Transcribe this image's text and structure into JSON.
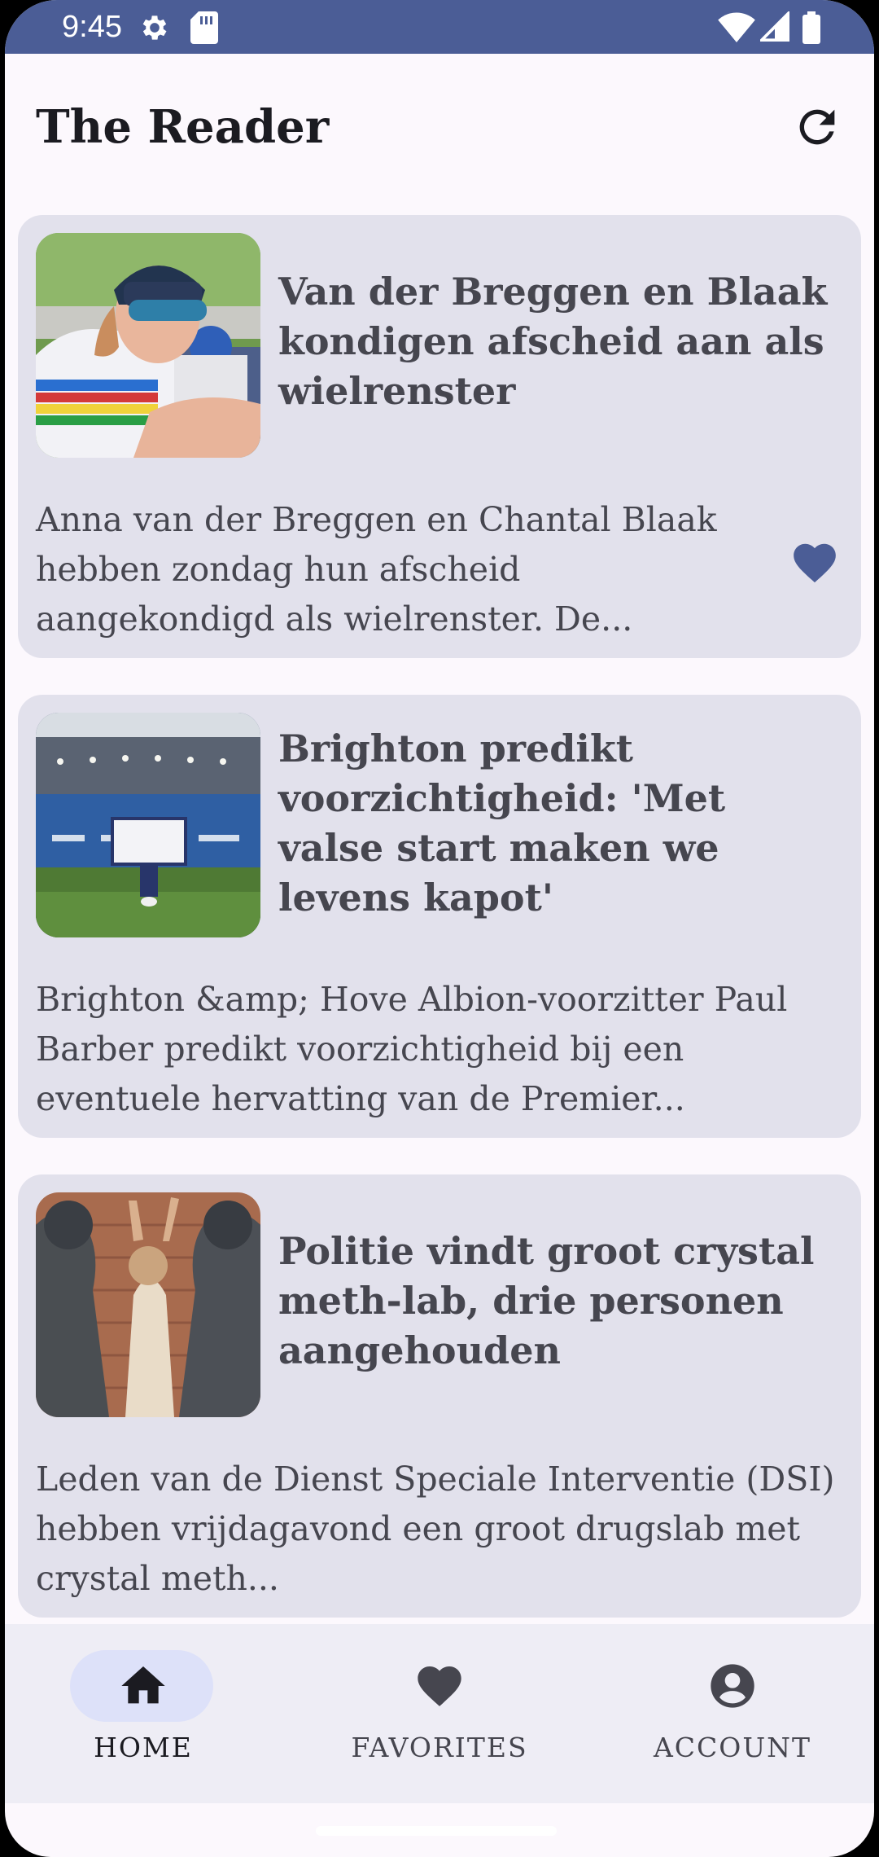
{
  "status_bar": {
    "time": "9:45",
    "icons": [
      "settings-icon",
      "sim-card-icon",
      "wifi-icon",
      "signal-icon",
      "battery-icon"
    ]
  },
  "app": {
    "title": "The Reader",
    "refresh_icon": "refresh-icon"
  },
  "articles": [
    {
      "title": "Van der Breggen en Blaak kondigen afscheid aan als wielrenster",
      "description": "Anna van der Breggen en Chantal Blaak hebben zondag hun afscheid aangekondigd als wielrenster. De...",
      "favorited": true
    },
    {
      "title": "Brighton predikt voorzichtigheid: 'Met valse start maken we levens kapot'",
      "description": "Brighton &amp; Hove Albion-voorzitter Paul Barber predikt voorzichtigheid bij een eventuele hervatting van de Premier...",
      "favorited": false
    },
    {
      "title": "Politie vindt groot crystal meth-lab, drie personen aangehouden",
      "description": "Leden van de Dienst Speciale Interventie (DSI) hebben vrijdagavond een groot drugslab met crystal meth...",
      "favorited": false
    }
  ],
  "bottom_nav": {
    "items": [
      {
        "label": "HOME",
        "icon": "home-icon",
        "active": true
      },
      {
        "label": "FAVORITES",
        "icon": "heart-icon",
        "active": false
      },
      {
        "label": "ACCOUNT",
        "icon": "account-circle-icon",
        "active": false
      }
    ]
  },
  "colors": {
    "status_bar": "#4b5d96",
    "background": "#fcf8fd",
    "card": "#e2e1ec",
    "accent": "#4b5d96",
    "nav_background": "#eeedf5",
    "nav_active_pill": "#dde1f9"
  }
}
